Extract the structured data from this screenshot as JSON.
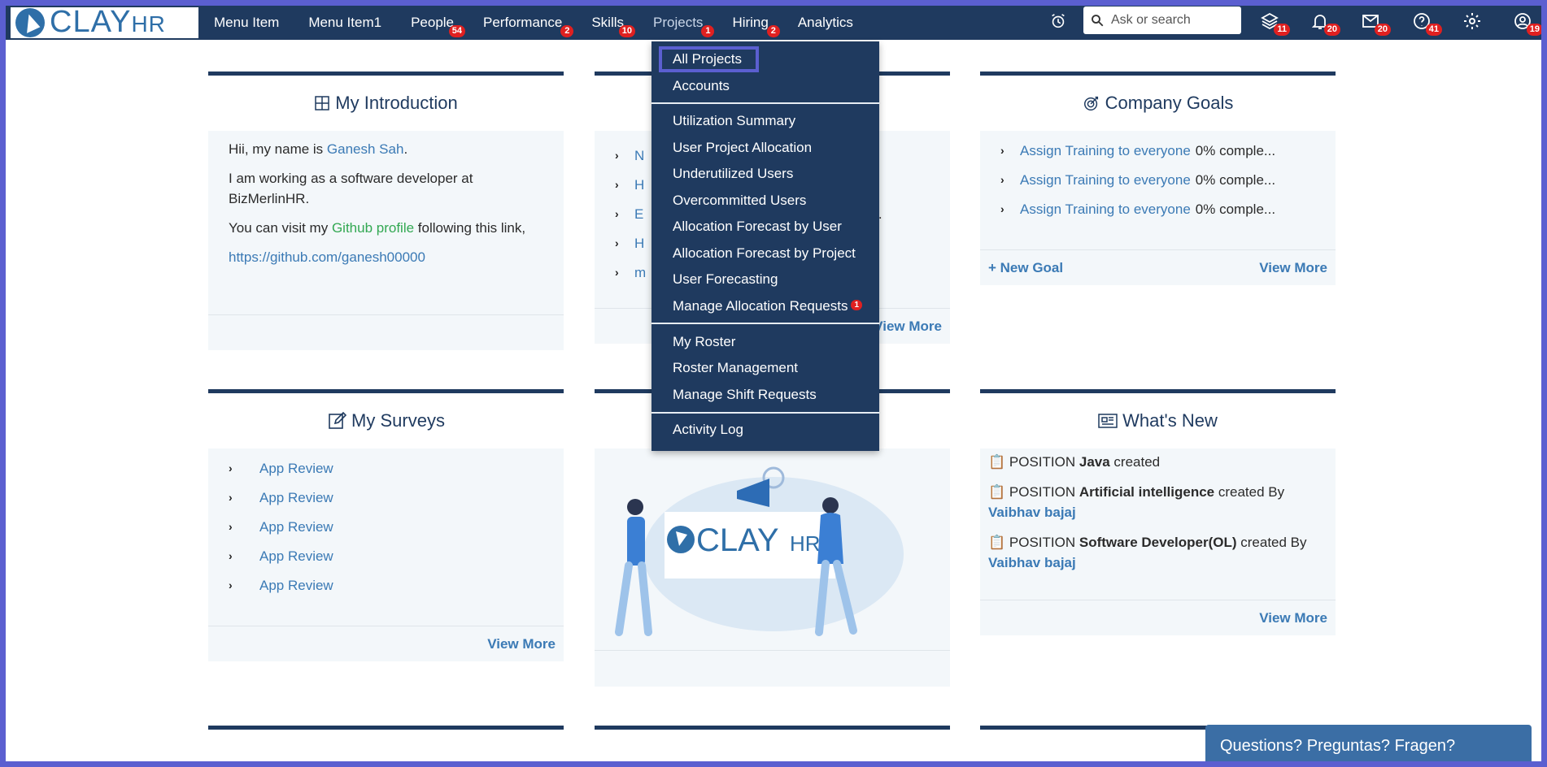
{
  "app": {
    "logo_text": "CLAY",
    "logo_suffix": "HR"
  },
  "nav": {
    "items": [
      {
        "label": "Menu Item",
        "badge": ""
      },
      {
        "label": "Menu Item1",
        "badge": ""
      },
      {
        "label": "People",
        "badge": "54"
      },
      {
        "label": "Performance",
        "badge": "2"
      },
      {
        "label": "Skills",
        "badge": "10"
      },
      {
        "label": "Projects",
        "badge": "1"
      },
      {
        "label": "Hiring",
        "badge": "2"
      },
      {
        "label": "Analytics",
        "badge": ""
      }
    ],
    "search_placeholder": "Ask or search",
    "icons": [
      {
        "name": "alarm-clock-icon",
        "badge": ""
      },
      {
        "name": "layers-icon",
        "badge": "11"
      },
      {
        "name": "bell-icon",
        "badge": "20"
      },
      {
        "name": "mail-icon",
        "badge": "20"
      },
      {
        "name": "help-icon",
        "badge": "41"
      },
      {
        "name": "gear-icon",
        "badge": ""
      },
      {
        "name": "support-icon",
        "badge": "19"
      }
    ]
  },
  "dropdown": {
    "items": [
      "All Projects",
      "Accounts",
      "Utilization Summary",
      "User Project Allocation",
      "Underutilized Users",
      "Overcommitted Users",
      "Allocation Forecast by User",
      "Allocation Forecast by Project",
      "User Forecasting",
      "Manage Allocation Requests",
      "My Roster",
      "Roster Management",
      "Manage Shift Requests",
      "Activity Log"
    ],
    "manage_allocation_badge": "1",
    "selected": "All Projects"
  },
  "intro": {
    "title": "My Introduction",
    "line1_prefix": "Hii, my name is ",
    "name": "Ganesh Sah",
    "line1_suffix": ".",
    "line2": "I am working as a software developer at BizMerlinHR.",
    "line3_prefix": "You can visit my ",
    "github_text": "Github profile",
    "line3_suffix": " following this link,",
    "github_url": "https://github.com/ganesh00000"
  },
  "middle_card": {
    "partial_rows": [
      "N",
      "H",
      "E",
      "H",
      "m"
    ],
    "partial_suffix": "2...",
    "view_more": "View More"
  },
  "goals": {
    "title": "Company Goals",
    "rows": [
      {
        "label": "Assign Training to everyone",
        "pct": "0% comple..."
      },
      {
        "label": "Assign Training to everyone",
        "pct": "0% comple..."
      },
      {
        "label": "Assign Training to everyone",
        "pct": "0% comple..."
      }
    ],
    "new_goal": "+ New Goal",
    "view_more": "View More"
  },
  "surveys": {
    "title": "My Surveys",
    "rows": [
      "App Review",
      "App Review",
      "App Review",
      "App Review",
      "App Review"
    ],
    "view_more": "View More"
  },
  "whats_new": {
    "title": "What's New",
    "items": [
      {
        "prefix": "POSITION ",
        "bold": "Java",
        "suffix": " created",
        "by": ""
      },
      {
        "prefix": "POSITION ",
        "bold": "Artificial intelligence",
        "suffix": " created By ",
        "by": "Vaibhav bajaj"
      },
      {
        "prefix": "POSITION ",
        "bold": "Software Developer(OL)",
        "suffix": " created By ",
        "by": "Vaibhav bajaj"
      }
    ],
    "view_more": "View More"
  },
  "illustration": {
    "logo_text": "CLAY",
    "logo_suffix": "HR"
  },
  "chat": {
    "label": "Questions? Preguntas? Fragen?"
  },
  "colors": {
    "navbar": "#1f3a5f",
    "frame": "#5b5fd0",
    "link": "#3b7ab5",
    "badge": "#e02020"
  }
}
